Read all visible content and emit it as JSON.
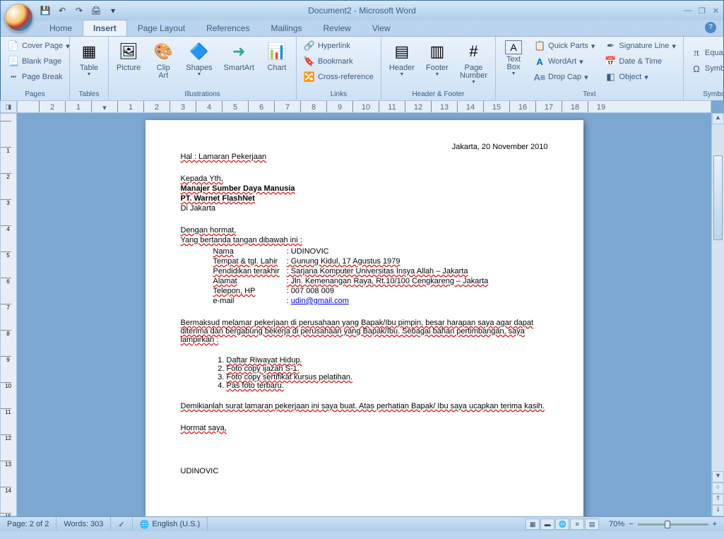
{
  "title": "Document2 - Microsoft Word",
  "qat": {
    "save": "💾",
    "undo": "↶",
    "redo": "↷",
    "print": "🖨"
  },
  "tabs": [
    "Home",
    "Insert",
    "Page Layout",
    "References",
    "Mailings",
    "Review",
    "View"
  ],
  "active_tab": 1,
  "ribbon": {
    "pages": {
      "label": "Pages",
      "cover": "Cover Page",
      "blank": "Blank Page",
      "break": "Page Break"
    },
    "tables": {
      "label": "Tables",
      "table": "Table"
    },
    "illustrations": {
      "label": "Illustrations",
      "picture": "Picture",
      "clipart": "Clip\nArt",
      "shapes": "Shapes",
      "smartart": "SmartArt",
      "chart": "Chart"
    },
    "links": {
      "label": "Links",
      "hyperlink": "Hyperlink",
      "bookmark": "Bookmark",
      "crossref": "Cross-reference"
    },
    "headerfooter": {
      "label": "Header & Footer",
      "header": "Header",
      "footer": "Footer",
      "pagenum": "Page\nNumber"
    },
    "text": {
      "label": "Text",
      "textbox": "Text\nBox",
      "quickparts": "Quick Parts",
      "wordart": "WordArt",
      "dropcap": "Drop Cap",
      "sigline": "Signature Line",
      "datetime": "Date & Time",
      "object": "Object"
    },
    "symbols": {
      "label": "Symbols",
      "equation": "Equation",
      "symbol": "Symbol"
    }
  },
  "doc": {
    "date": "Jakarta, 20 November 2010",
    "hal": "Hal : Lamaran Pekerjaan",
    "kepada": "Kepada Yth,",
    "manajer": "Manajer Sumber Daya Manusia",
    "pt": "PT. Warnet FlashNet",
    "di": "Di Jakarta",
    "dengan": "Dengan hormat,",
    "yang": "Yang bertanda tangan dibawah ini :",
    "info": {
      "nama_l": "Nama",
      "nama_v": ": UDINOVIC",
      "tempat_l": "Tempat & tgl. Lahir",
      "tempat_v": ": Gunung Kidul, 17 Agustus 1979",
      "pendidikan_l": "Pendidikan terakhir",
      "pendidikan_v": ": Sarjana Komputer Universitas Insya Allah – Jakarta",
      "alamat_l": "Alamat",
      "alamat_v": ": Jln. Kemenangan Raya, Rt.10/100 Cengkareng – Jakarta",
      "telepon_l": "Telepon, HP",
      "telepon_v": ": 007 008 009",
      "email_l": "e-mail",
      "email_pre": ": ",
      "email_v": "udin@gmail.com"
    },
    "bermaksud": "Bermaksud melamar pekerjaan di perusahaan yang Bapak/Ibu pimpin, besar harapan saya agar dapat diterima dan bergabung bekerja di perusahaan yang Bapak/Ibu. Sebagai bahan pertimbangan, saya lampirkan :",
    "attach": [
      "Daftar Riwayat Hidup.",
      "Foto copy ijazah S-1.",
      "Foto copy sertifikat kursus pelatihan.",
      "Pas foto terbaru."
    ],
    "demikian": "Demikianlah surat lamaran pekerjaan ini saya buat. Atas perhatian Bapak/ Ibu saya ucapkan terima kasih.",
    "hormat": "Hormat saya,",
    "nama_ttd": "UDINOVIC"
  },
  "status": {
    "page": "Page: 2 of 2",
    "words": "Words: 303",
    "lang": "English (U.S.)",
    "zoom": "70%"
  }
}
